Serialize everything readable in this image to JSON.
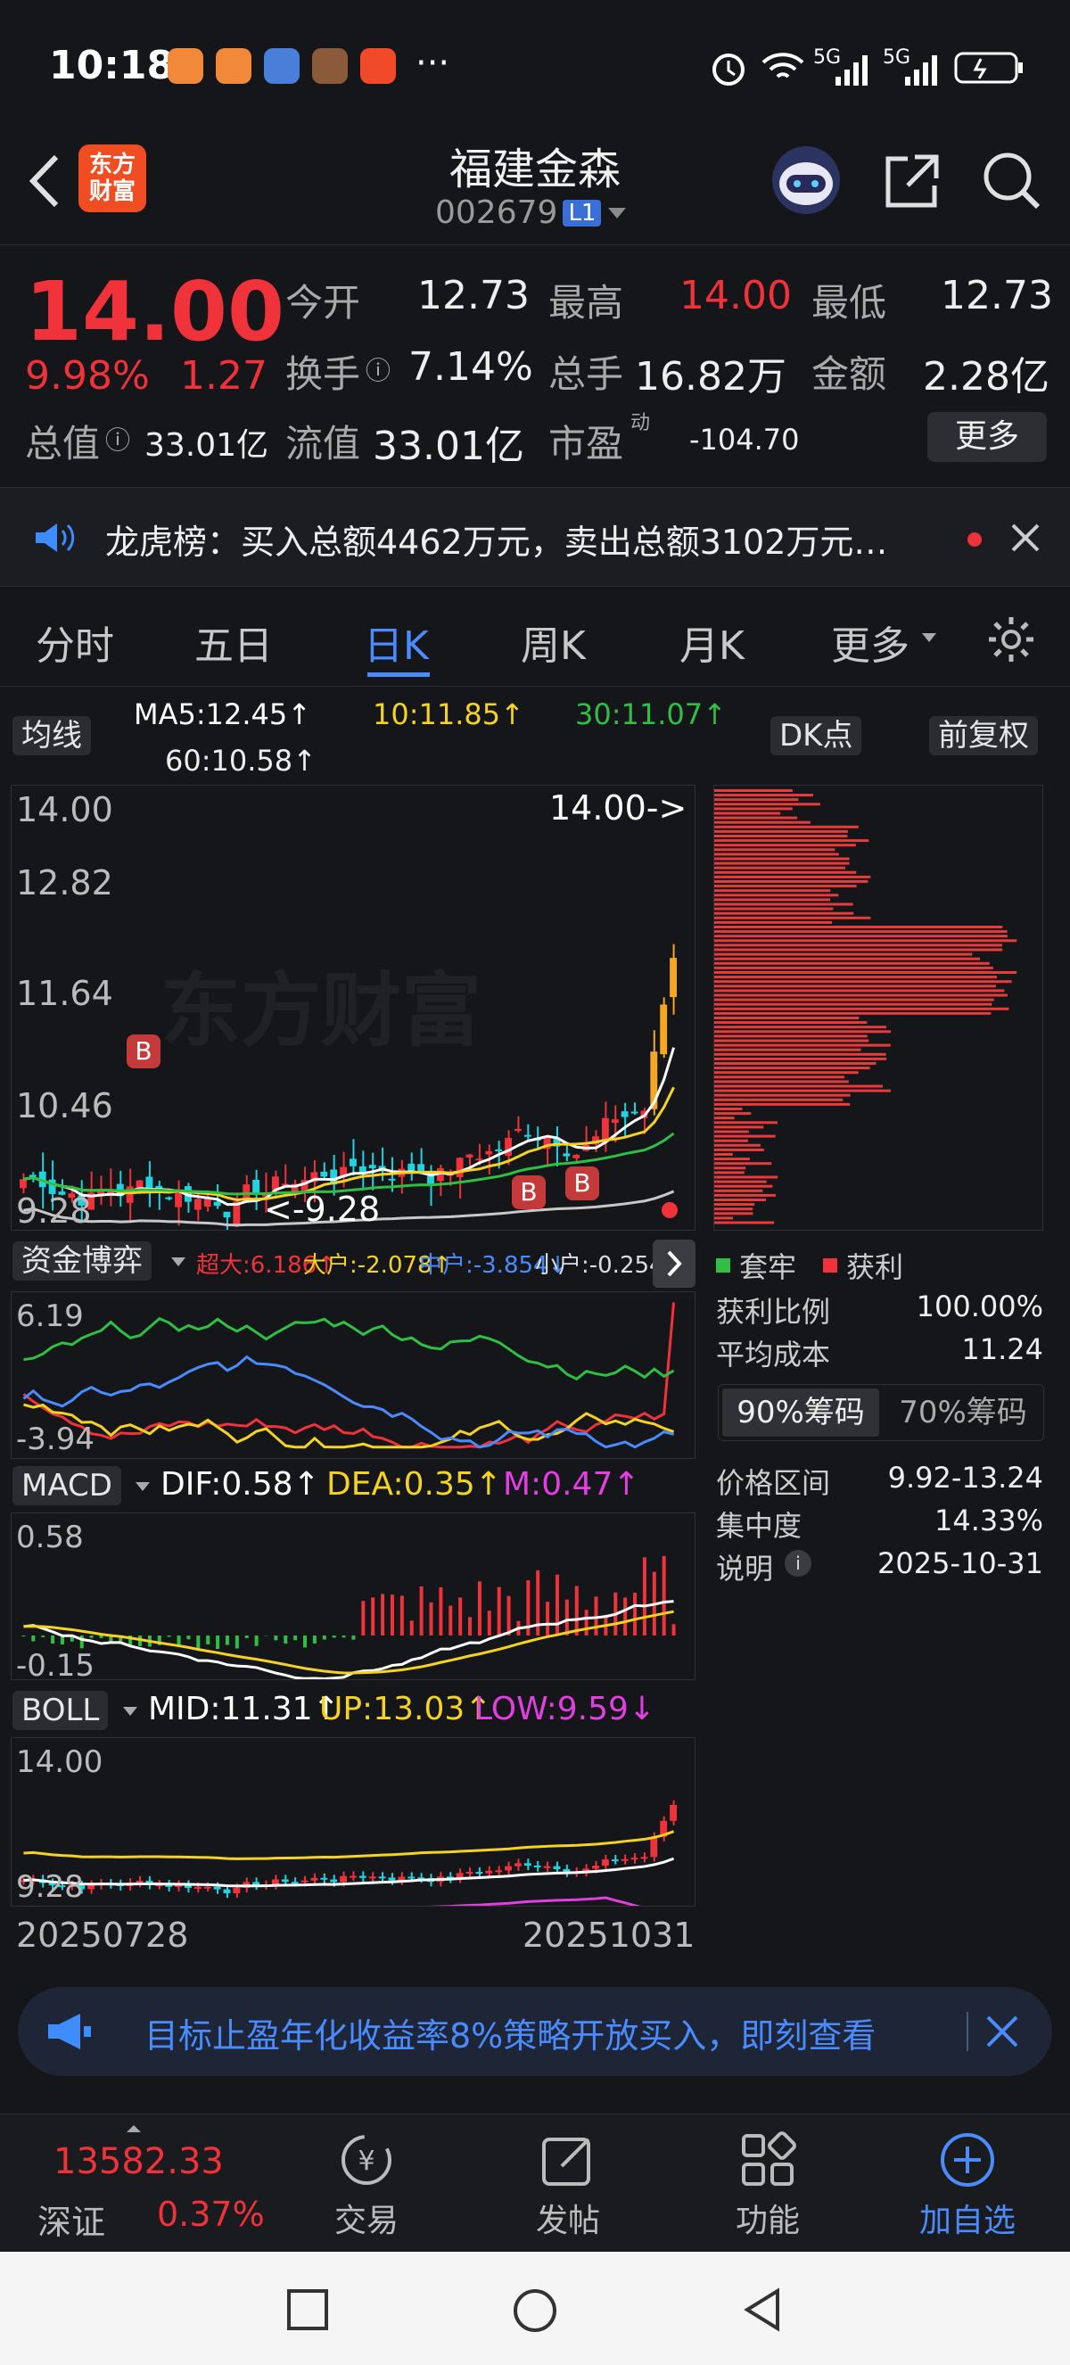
{
  "status_bar": {
    "time": "10:18",
    "more": "···",
    "network1": "5G",
    "network2": "5G"
  },
  "header": {
    "logo_text": "东方\n财富",
    "title": "福建金森",
    "code": "002679",
    "level_badge": "L1"
  },
  "quote": {
    "price": "14.00",
    "pct": "9.98%",
    "change": "1.27",
    "open_label": "今开",
    "open": "12.73",
    "high_label": "最高",
    "high": "14.00",
    "low_label": "最低",
    "low": "12.73",
    "turnover_label": "换手",
    "turnover": "7.14%",
    "volume_label": "总手",
    "volume": "16.82万",
    "amount_label": "金额",
    "amount": "2.28亿",
    "mcap_label": "总值",
    "mcap": "33.01亿",
    "float_label": "流值",
    "float": "33.01亿",
    "pe_label": "市盈",
    "pe_sup": "动",
    "pe": "-104.70",
    "more_button": "更多"
  },
  "notice": {
    "text": "龙虎榜：买入总额4462万元，卖出总额3102万元…"
  },
  "tabs": [
    "分时",
    "五日",
    "日K",
    "周K",
    "月K",
    "更多"
  ],
  "active_tab": "日K",
  "ma": {
    "label": "均线",
    "ma5": "MA5:12.45↑",
    "ma10": "10:11.85↑",
    "ma30": "30:11.07↑",
    "ma60": "60:10.58↑",
    "dk_button": "DK点",
    "adjust_button": "前复权"
  },
  "kline": {
    "y_labels": [
      "14.00",
      "12.82",
      "11.64",
      "10.46",
      "9.28"
    ],
    "high_marker": "14.00->",
    "low_marker": "<-9.28",
    "b_marker": "B",
    "watermark": "东方财富"
  },
  "flow": {
    "label": "资金博弈",
    "super": "超大:6.186↑",
    "big": "大户:-2.078↑",
    "mid": "中户:-3.854↓",
    "small": "小户:-0.254↓",
    "y_top": "6.19",
    "y_bottom": "-3.94"
  },
  "macd": {
    "label": "MACD",
    "dif": "DIF:0.58↑",
    "dea": "DEA:0.35↑",
    "m": "M:0.47↑",
    "y_top": "0.58",
    "y_bottom": "-0.15"
  },
  "boll": {
    "label": "BOLL",
    "mid": "MID:11.31↑",
    "up": "UP:13.03↑",
    "low": "LOW:9.59↓",
    "y_top": "14.00",
    "y_bottom": "9.28"
  },
  "dates": {
    "start": "20250728",
    "end": "20251031"
  },
  "chips": {
    "legend_trapped": "套牢",
    "legend_profit": "获利",
    "rows": [
      {
        "label": "获利比例",
        "value": "100.00%"
      },
      {
        "label": "平均成本",
        "value": "11.24"
      }
    ],
    "tab90": "90%筹码",
    "tab70": "70%筹码",
    "rows2": [
      {
        "label": "价格区间",
        "value": "9.92-13.24"
      },
      {
        "label": "集中度",
        "value": "14.33%"
      },
      {
        "label": "说明",
        "value": "2025-10-31"
      }
    ]
  },
  "banner": {
    "text": "目标止盈年化收益率8%策略开放买入，即刻查看"
  },
  "bottom_nav": {
    "index_value": "13582.33",
    "index_name": "深证",
    "index_pct": "0.37%",
    "items": [
      "交易",
      "发帖",
      "功能",
      "加自选"
    ]
  },
  "colors": {
    "up": "#f0323a",
    "down": "#1fd3e0",
    "accent": "#4a8cff",
    "ma5": "#ffffff",
    "ma10": "#f5d322",
    "ma30": "#2fbf44",
    "ma60": "#c8c8c8"
  }
}
